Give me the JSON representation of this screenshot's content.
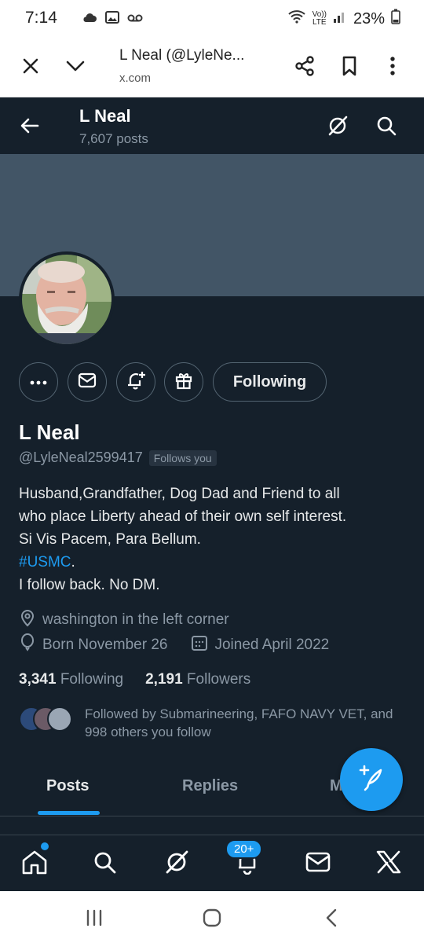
{
  "status_bar": {
    "time": "7:14",
    "battery": "23%",
    "network": "LTE",
    "network_prefix": "Vo))"
  },
  "browser": {
    "page_title": "L Neal (@LyleNe...",
    "url": "x.com"
  },
  "header": {
    "name": "L Neal",
    "post_count": "7,607 posts"
  },
  "profile": {
    "display_name": "L Neal",
    "handle": "@LyleNeal2599417",
    "follows_you": "Follows you",
    "following_button": "Following",
    "bio_line1": "Husband,Grandfather, Dog Dad and Friend to all",
    "bio_line2": "who place Liberty ahead of their own self interest.",
    "bio_line3": "Si Vis Pacem, Para Bellum.",
    "hashtag": "#USMC",
    "hashtag_suffix": ".",
    "bio_line5": "I follow back. No DM.",
    "location": "washington in the left corner",
    "born": "Born November 26",
    "joined": "Joined April 2022",
    "following_count": "3,341",
    "following_label": "Following",
    "followers_count": "2,191",
    "followers_label": "Followers",
    "followed_by": "Followed by Submarineering, FAFO NAVY VET, and 998 others you follow"
  },
  "tabs": [
    "Posts",
    "Replies",
    "M"
  ],
  "bottom_nav": {
    "notifications_badge": "20+"
  },
  "colors": {
    "background": "#15202b",
    "banner": "#425566",
    "accent": "#1d9bf0",
    "muted_text": "#8b98a5"
  }
}
